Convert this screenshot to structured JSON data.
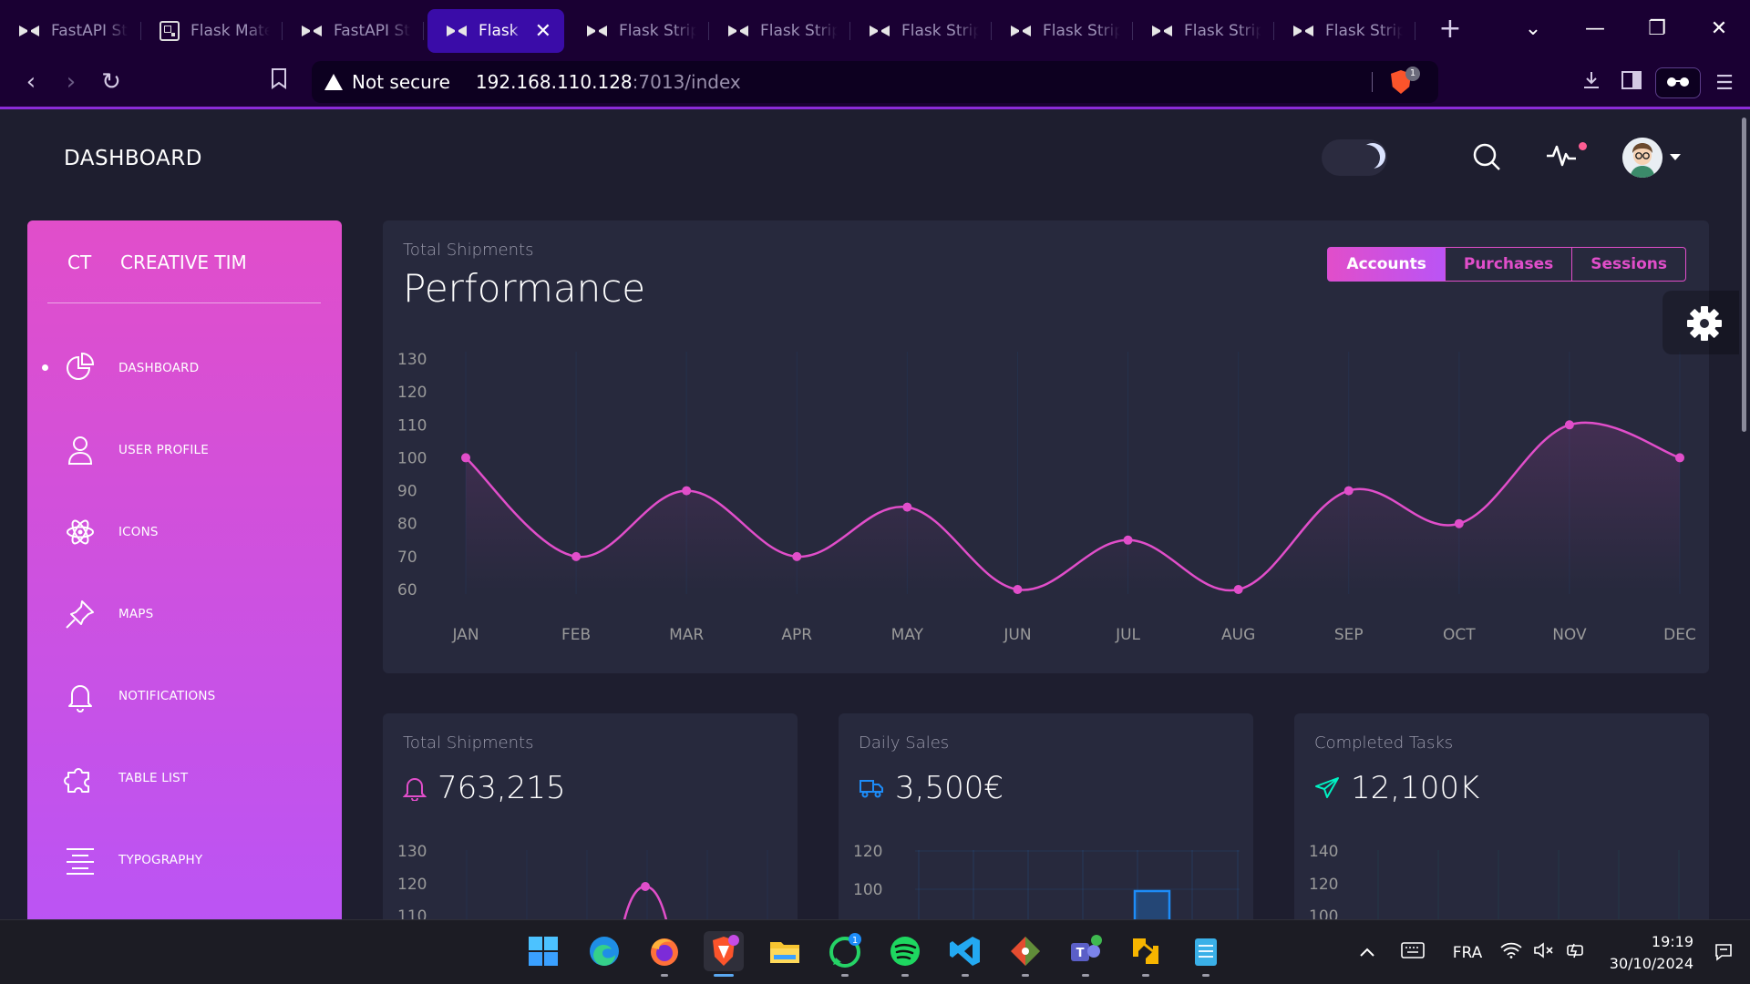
{
  "browser": {
    "tabs": [
      {
        "title": "FastAPI Stripe",
        "icon": "bowtie-icon"
      },
      {
        "title": "Flask Material",
        "icon": "qr-icon"
      },
      {
        "title": "FastAPI Stripe",
        "icon": "bowtie-icon"
      },
      {
        "title": "Flask Black",
        "icon": "bowtie-icon",
        "active": true
      },
      {
        "title": "Flask Stripe",
        "icon": "bowtie-icon"
      },
      {
        "title": "Flask Stripe",
        "icon": "bowtie-icon"
      },
      {
        "title": "Flask Stripe",
        "icon": "bowtie-icon"
      },
      {
        "title": "Flask Stripe",
        "icon": "bowtie-icon"
      },
      {
        "title": "Flask Stripe",
        "icon": "bowtie-icon"
      },
      {
        "title": "Flask Stripe",
        "icon": "bowtie-icon"
      }
    ],
    "security_label": "Not secure",
    "url_host": "192.168.110.128",
    "url_path": ":7013/index",
    "shield_count": "1",
    "accent": "#8b2bd8"
  },
  "header": {
    "title": "DASHBOARD"
  },
  "sidebar": {
    "logo_mini": "CT",
    "logo_text": "CREATIVE TIM",
    "items": [
      {
        "label": "DASHBOARD",
        "icon": "chart-pie-icon",
        "active": true
      },
      {
        "label": "USER PROFILE",
        "icon": "user-icon"
      },
      {
        "label": "ICONS",
        "icon": "atom-icon"
      },
      {
        "label": "MAPS",
        "icon": "pin-icon"
      },
      {
        "label": "NOTIFICATIONS",
        "icon": "bell-icon"
      },
      {
        "label": "TABLE LIST",
        "icon": "puzzle-icon"
      },
      {
        "label": "TYPOGRAPHY",
        "icon": "align-center-icon"
      }
    ],
    "gradient_top": "#e14eca",
    "gradient_bottom": "#ba54f5"
  },
  "performance": {
    "category": "Total Shipments",
    "title": "Performance",
    "buttons": [
      "Accounts",
      "Purchases",
      "Sessions"
    ],
    "active_button": "Accounts"
  },
  "stats": [
    {
      "category": "Total Shipments",
      "value": "763,215",
      "icon": "bell-icon",
      "color": "#e14eca"
    },
    {
      "category": "Daily Sales",
      "value": "3,500€",
      "icon": "delivery-truck-icon",
      "color": "#1d8cf8"
    },
    {
      "category": "Completed Tasks",
      "value": "12,100K",
      "icon": "send-icon",
      "color": "#00f2c3"
    }
  ],
  "chart_data": [
    {
      "type": "line",
      "categories": [
        "JAN",
        "FEB",
        "MAR",
        "APR",
        "MAY",
        "JUN",
        "JUL",
        "AUG",
        "SEP",
        "OCT",
        "NOV",
        "DEC"
      ],
      "values": [
        100,
        70,
        90,
        70,
        85,
        60,
        75,
        60,
        90,
        80,
        110,
        100
      ],
      "yticks": [
        60,
        70,
        80,
        90,
        100,
        110,
        120,
        130
      ],
      "ylim": [
        60,
        130
      ],
      "color": "#e14eca",
      "grid": "vertical"
    },
    {
      "type": "line",
      "yticks_visible": [
        130,
        120,
        110
      ],
      "color": "#e14eca",
      "note_visible": "partially visible, cropped"
    },
    {
      "type": "bar",
      "yticks_visible": [
        120,
        100
      ],
      "color": "#1d8cf8"
    },
    {
      "type": "line",
      "yticks_visible": [
        140,
        120,
        100
      ],
      "color": "#00f2c3"
    }
  ],
  "taskbar": {
    "language": "FRA",
    "time": "19:19",
    "date": "30/10/2024",
    "whatsapp_badge": "1"
  }
}
